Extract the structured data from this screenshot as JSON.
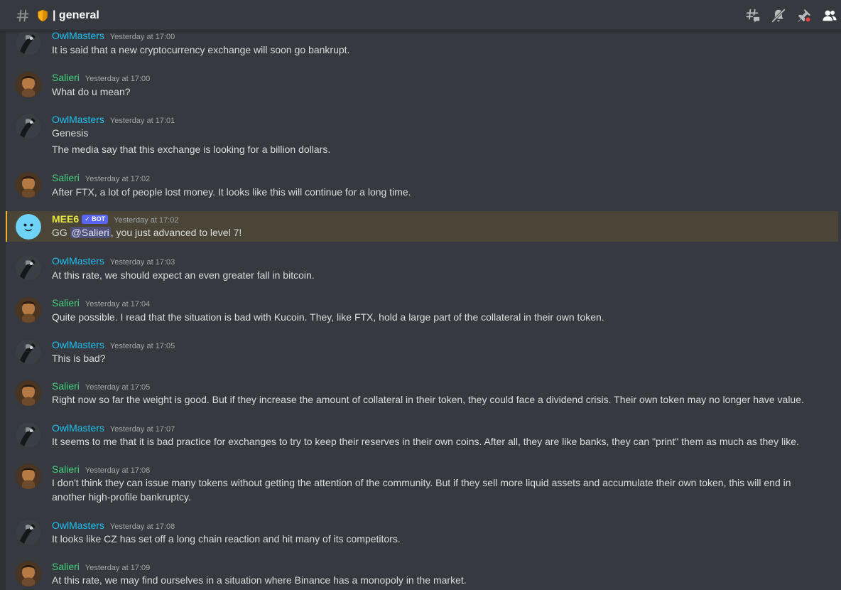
{
  "header": {
    "channel_name": "general",
    "separator": "|",
    "icons": [
      "hash-icon",
      "shield-icon",
      "threads-icon",
      "mute-icon",
      "pin-icon",
      "members-icon"
    ]
  },
  "colors": {
    "owl_name": "#1ec1f1",
    "salieri_name": "#43d17d",
    "mee6_name": "#e6e83d",
    "highlight_bg": "#4a4537",
    "bot_tag": "#5865f2"
  },
  "messages": [
    {
      "author": "OwlMasters",
      "time": "Yesterday at 17:00",
      "lines": [
        "It is said that a new cryptocurrency exchange will soon go bankrupt."
      ]
    },
    {
      "author": "Salieri",
      "time": "Yesterday at 17:00",
      "lines": [
        "What do u mean?"
      ]
    },
    {
      "author": "OwlMasters",
      "time": "Yesterday at 17:01",
      "lines": [
        "Genesis",
        "The media say that this exchange is looking for a billion dollars."
      ]
    },
    {
      "author": "Salieri",
      "time": "Yesterday at 17:02",
      "lines": [
        "After FTX, a lot of people lost money. It looks like this will continue for a long time."
      ]
    },
    {
      "author": "MEE6",
      "bot_tag": "✓ BOT",
      "time": "Yesterday at 17:02",
      "prefix": "GG ",
      "mention": "@Salieri",
      "suffix": ", you just advanced to level 7!"
    },
    {
      "author": "OwlMasters",
      "time": "Yesterday at 17:03",
      "lines": [
        "At this rate, we should expect an even greater fall in bitcoin."
      ]
    },
    {
      "author": "Salieri",
      "time": "Yesterday at 17:04",
      "lines": [
        "Quite possible. I read that the situation is bad with Kucoin. They, like FTX, hold a large part of the collateral in their own token."
      ]
    },
    {
      "author": "OwlMasters",
      "time": "Yesterday at 17:05",
      "lines": [
        "This is bad?"
      ]
    },
    {
      "author": "Salieri",
      "time": "Yesterday at 17:05",
      "lines": [
        "Right now so far the weight is good. But if they increase the amount of collateral in their token, they could face a dividend crisis. Their own token may no longer have value."
      ]
    },
    {
      "author": "OwlMasters",
      "time": "Yesterday at 17:07",
      "lines": [
        "It seems to me that it is bad practice for exchanges to try to keep their reserves in their own coins. After all, they are like banks, they can \"print\" them as much as they like."
      ]
    },
    {
      "author": "Salieri",
      "time": "Yesterday at 17:08",
      "lines": [
        "I don't think they can issue many tokens without getting the attention of the community. But if they sell more liquid assets and accumulate their own token, this will end in another high-profile bankruptcy."
      ]
    },
    {
      "author": "OwlMasters",
      "time": "Yesterday at 17:08",
      "lines": [
        "It looks like CZ has set off a long chain reaction and hit many of its competitors."
      ]
    },
    {
      "author": "Salieri",
      "time": "Yesterday at 17:09",
      "lines": [
        "At this rate, we may find ourselves in a situation where Binance has a monopoly in the market."
      ]
    }
  ]
}
